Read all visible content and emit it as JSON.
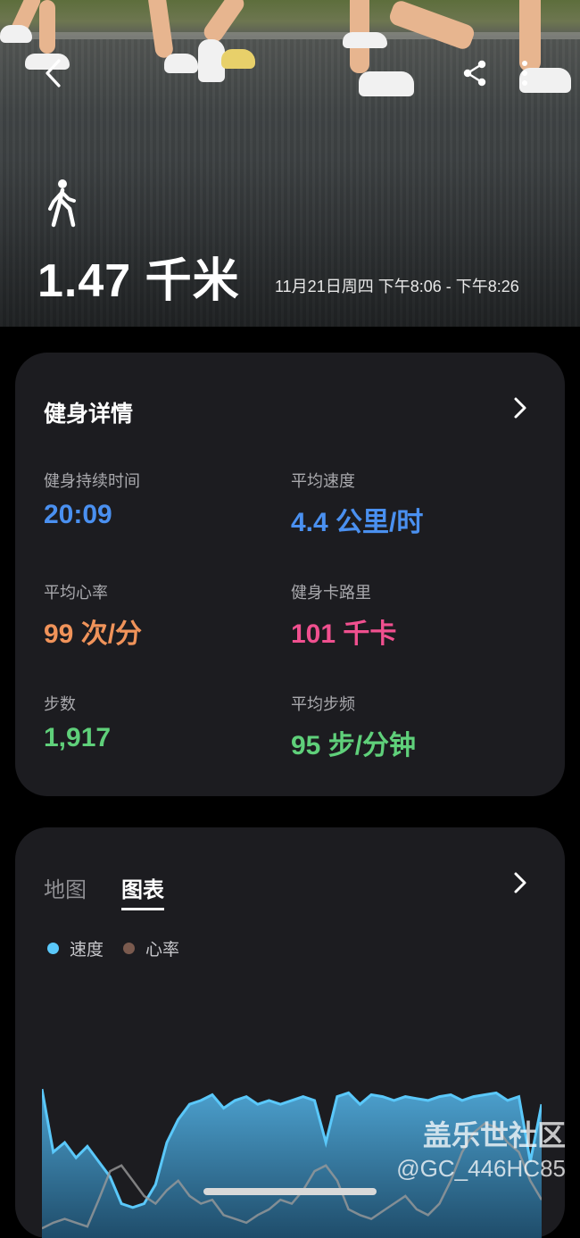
{
  "hero": {
    "distance": "1.47 千米",
    "time_range": "11月21日周四 下午8:06 - 下午8:26",
    "icons": [
      "back-icon",
      "share-icon",
      "more-icon",
      "walk-icon"
    ]
  },
  "details": {
    "title": "健身详情",
    "stats": [
      {
        "label": "健身持续时间",
        "value": "20:09",
        "color": "#4a90f0"
      },
      {
        "label": "平均速度",
        "value": "4.4 公里/时",
        "color": "#4a90f0"
      },
      {
        "label": "平均心率",
        "value": "99 次/分",
        "color": "#f0935a"
      },
      {
        "label": "健身卡路里",
        "value": "101 千卡",
        "color": "#f0508f"
      },
      {
        "label": "步数",
        "value": "1,917",
        "color": "#5fd07a"
      },
      {
        "label": "平均步频",
        "value": "95 步/分钟",
        "color": "#5fd07a"
      }
    ]
  },
  "chart_card": {
    "tabs": [
      {
        "label": "地图",
        "active": false
      },
      {
        "label": "图表",
        "active": true
      }
    ],
    "legend": [
      {
        "label": "速度",
        "color": "#5ac8fa"
      },
      {
        "label": "心率",
        "color": "#7a5a4e"
      }
    ]
  },
  "chart_data": {
    "type": "area",
    "series": [
      {
        "name": "速度",
        "color": "#5ac8fa",
        "values": [
          0.78,
          0.45,
          0.5,
          0.42,
          0.48,
          0.4,
          0.32,
          0.18,
          0.16,
          0.18,
          0.28,
          0.5,
          0.62,
          0.7,
          0.72,
          0.75,
          0.68,
          0.72,
          0.74,
          0.7,
          0.72,
          0.7,
          0.72,
          0.74,
          0.72,
          0.5,
          0.74,
          0.76,
          0.7,
          0.75,
          0.74,
          0.72,
          0.74,
          0.73,
          0.72,
          0.74,
          0.75,
          0.72,
          0.74,
          0.75,
          0.76,
          0.72,
          0.74,
          0.4,
          0.7
        ]
      },
      {
        "name": "心率",
        "color": "#9a9a9a",
        "values": [
          0.05,
          0.08,
          0.1,
          0.08,
          0.06,
          0.2,
          0.35,
          0.38,
          0.3,
          0.22,
          0.18,
          0.25,
          0.3,
          0.22,
          0.18,
          0.2,
          0.12,
          0.1,
          0.08,
          0.12,
          0.15,
          0.2,
          0.18,
          0.25,
          0.35,
          0.38,
          0.3,
          0.15,
          0.12,
          0.1,
          0.14,
          0.18,
          0.22,
          0.15,
          0.12,
          0.18,
          0.3,
          0.45,
          0.55,
          0.6,
          0.58,
          0.5,
          0.45,
          0.3,
          0.2
        ]
      }
    ]
  },
  "watermark": {
    "line1": "盖乐世社区",
    "line2": "@GC_446HC85"
  }
}
